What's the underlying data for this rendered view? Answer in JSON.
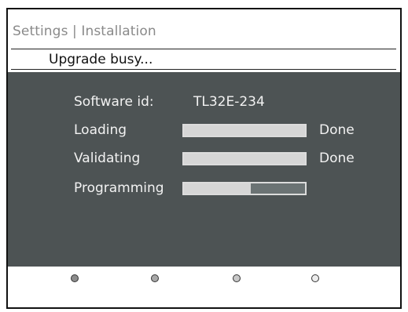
{
  "header": {
    "breadcrumb": "Settings | Installation",
    "status": "Upgrade busy..."
  },
  "panel": {
    "software_id_label": "Software id:",
    "software_id_value": "TL32E-234",
    "rows": [
      {
        "label": "Loading",
        "progress": 1.0,
        "status": "Done"
      },
      {
        "label": "Validating",
        "progress": 1.0,
        "status": "Done"
      },
      {
        "label": "Programming",
        "progress": 0.55,
        "status": ""
      }
    ]
  },
  "footer": {
    "color_keys": [
      "#8c8c8c",
      "#a8a8a8",
      "#c8c8c8",
      "#ececec"
    ]
  }
}
